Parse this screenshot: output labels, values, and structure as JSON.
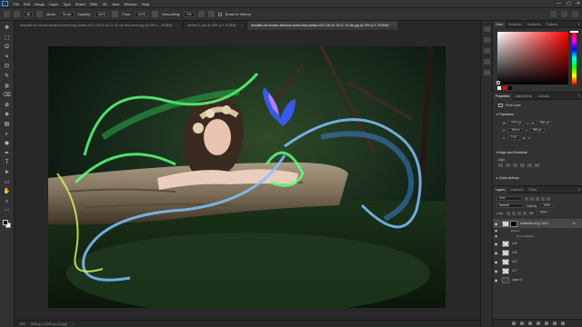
{
  "app": {
    "logo": "Ps"
  },
  "menu": [
    "File",
    "Edit",
    "Image",
    "Layer",
    "Type",
    "Select",
    "Filter",
    "3D",
    "View",
    "Window",
    "Help"
  ],
  "window_controls": [
    "—",
    "▢",
    "✕"
  ],
  "options_bar": {
    "brush_size": "46",
    "mode_label": "Mode:",
    "mode_value": "Brush",
    "opacity_label": "Opacity:",
    "opacity_value": "100%",
    "flow_label": "Flow:",
    "flow_value": "100%",
    "smoothing_label": "Smoothing:",
    "smoothing_value": "0%",
    "erase_history_label": "Erase to History"
  },
  "tabs": [
    {
      "label": "beautiful-elf-woman-fabulous-forest-fairy-fantas-2021-09-02-18-47-25-utc-Recovered.jpg @ 25% (... RGB/8) *",
      "active": false
    },
    {
      "label": "Untitled-1.psd @ 25% (L3, RGB/8) *",
      "active": false
    },
    {
      "label": "beautiful-elf-woman-fabulous-forest-fairy-fantas-2021-09-02-18-47-25-utc.jpg @ 25% (L3, RGB/8) *",
      "active": true
    }
  ],
  "tools": [
    "✥",
    "⬚",
    "ʘ",
    "⌖",
    "⊡",
    "✎",
    "◍",
    "⌫",
    "⊕",
    "◈",
    "▤",
    "◐",
    "◉",
    "✒",
    "T",
    "➤",
    "▭",
    "✋",
    "⌕",
    "⋯"
  ],
  "status": {
    "zoom": "25%",
    "doc_info": "3000 px x 2000 px (72 ppi)",
    "arrow": "›"
  },
  "color_panel": {
    "tabs": [
      {
        "label": "Color",
        "active": true
      },
      {
        "label": "Swatches",
        "active": false
      },
      {
        "label": "Gradients",
        "active": false
      },
      {
        "label": "Patterns",
        "active": false
      }
    ],
    "menu_icon": "≡",
    "chips": [
      "#ffffff",
      "#ff0000",
      "#000000"
    ]
  },
  "properties": {
    "tabs": [
      {
        "label": "Properties",
        "active": true
      },
      {
        "label": "Adjustments",
        "active": false
      },
      {
        "label": "Libraries",
        "active": false
      }
    ],
    "kind": "Pixel Layer",
    "transform_title": "Transform",
    "w_label": "W",
    "w": "2721 px",
    "h_label": "H",
    "h": "1391 px",
    "x_label": "X",
    "x": "-160 px",
    "y_label": "Y",
    "y": "983 px",
    "angle": "0.00°",
    "align_title": "Align and Distribute",
    "align_label": "Align:",
    "quick_actions_title": "Quick Actions"
  },
  "layers": {
    "tabs": [
      {
        "label": "Layers",
        "active": true
      },
      {
        "label": "Channels",
        "active": false
      },
      {
        "label": "Paths",
        "active": false
      }
    ],
    "filter_label": "Kind",
    "blend_mode": "Normal",
    "opacity_label": "Opacity:",
    "opacity": "100%",
    "lock_label": "Lock:",
    "fill_label": "Fill:",
    "fill": "100%",
    "fx_mark": "fx",
    "items": [
      {
        "name": "butterflies-png-19344",
        "visible": true,
        "selected": true,
        "has_mask": true,
        "thumb": "checker"
      },
      {
        "name": "L16",
        "visible": true,
        "selected": false,
        "has_mask": false,
        "thumb": "checker"
      },
      {
        "name": "L15",
        "visible": true,
        "selected": false,
        "has_mask": false,
        "thumb": "checker"
      },
      {
        "name": "L12",
        "visible": true,
        "selected": false,
        "has_mask": false,
        "thumb": "checker"
      },
      {
        "name": "L17",
        "visible": true,
        "selected": false,
        "has_mask": false,
        "thumb": "checker"
      },
      {
        "name": "Layer 0",
        "visible": true,
        "selected": false,
        "has_mask": false,
        "thumb": "photo"
      }
    ],
    "effects_label": "Effects",
    "drop_shadow_label": "Drop Shadow"
  },
  "colors": {
    "accent": "#31a8ff",
    "panel_bg": "#323232",
    "canvas_bg": "#282828"
  }
}
